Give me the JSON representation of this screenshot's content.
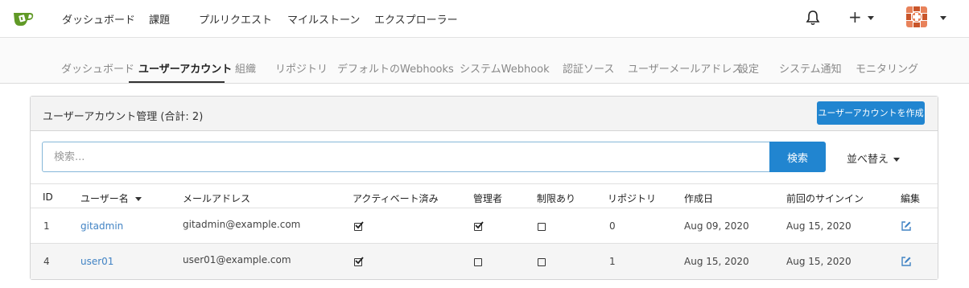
{
  "nav": {
    "items": [
      {
        "label": "ダッシュボード"
      },
      {
        "label": "課題"
      },
      {
        "label": "プルリクエスト"
      },
      {
        "label": "マイルストーン"
      },
      {
        "label": "エクスプローラー"
      }
    ],
    "create_symbol": "+"
  },
  "admin_tabs": [
    {
      "label": "ダッシュボード"
    },
    {
      "label": "ユーザーアカウント"
    },
    {
      "label": "組織"
    },
    {
      "label": "リポジトリ"
    },
    {
      "label": "デフォルトのWebhooks"
    },
    {
      "label": "システムWebhook"
    },
    {
      "label": "認証ソース"
    },
    {
      "label": "ユーザーメールアドレス"
    },
    {
      "label": "設定"
    },
    {
      "label": "システム通知"
    },
    {
      "label": "モニタリング"
    }
  ],
  "panel": {
    "title": "ユーザーアカウント管理 (合計: 2)",
    "create_button": "ユーザーアカウントを作成"
  },
  "search": {
    "placeholder": "検索...",
    "button": "検索",
    "sort_label": "並べ替え"
  },
  "table": {
    "headers": [
      "ID",
      "ユーザー名",
      "メールアドレス",
      "アクティベート済み",
      "管理者",
      "制限あり",
      "リポジトリ",
      "作成日",
      "前回のサインイン",
      "編集"
    ],
    "rows": [
      {
        "id": "1",
        "username": "gitadmin",
        "email": "gitadmin@example.com",
        "activated": true,
        "admin": true,
        "restricted": false,
        "repos": "0",
        "created": "Aug 09, 2020",
        "last_signin": "Aug 15, 2020"
      },
      {
        "id": "4",
        "username": "user01",
        "email": "user01@example.com",
        "activated": true,
        "admin": false,
        "restricted": false,
        "repos": "1",
        "created": "Aug 15, 2020",
        "last_signin": "Aug 15, 2020"
      }
    ]
  },
  "colors": {
    "accent": "#2185d0",
    "link": "#4183c4",
    "logo_green": "#609926"
  },
  "icons": [
    "gitea-logo-icon",
    "bell-icon",
    "plus-icon",
    "avatar-icon",
    "chevron-down-icon",
    "checkbox-icon",
    "edit-icon"
  ]
}
